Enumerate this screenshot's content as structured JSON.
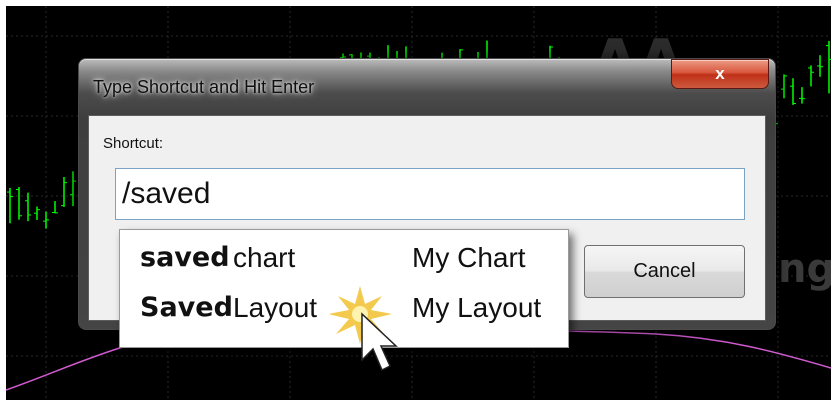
{
  "dialog": {
    "title": "Type Shortcut and Hit Enter",
    "close_label": "x",
    "shortcut_label": "Shortcut:",
    "shortcut_value": "/saved",
    "cancel_label": "Cancel"
  },
  "suggestions": [
    {
      "keyword": "saved",
      "type": "chart",
      "name": "My Chart"
    },
    {
      "keyword": "Saved",
      "type": "Layout",
      "name": "My Layout"
    }
  ],
  "colors": {
    "chart_background": "#000000",
    "price_bars": "#00ff00",
    "indicator_line": "#d05ad0",
    "close_button": "#c9432b"
  },
  "icons": [
    "mouse-pointer-icon",
    "click-burst-icon"
  ]
}
